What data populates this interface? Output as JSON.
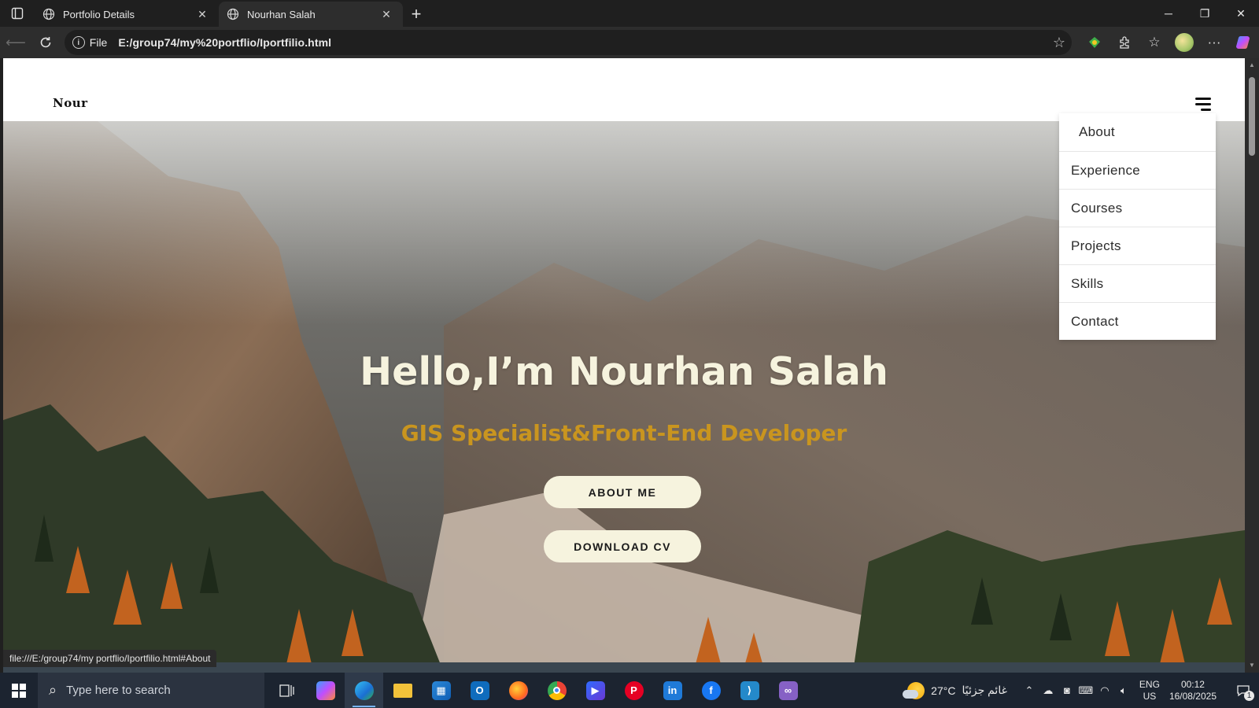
{
  "browser": {
    "tabs": [
      {
        "title": "Portfolio Details",
        "active": false
      },
      {
        "title": "Nourhan Salah",
        "active": true
      }
    ],
    "address": {
      "scheme_label": "File",
      "url": "E:/group74/my%20portflio/Iportfilio.html"
    },
    "status_url": "file:///E:/group74/my portflio/Iportfilio.html#About"
  },
  "site": {
    "logo": "Nour",
    "menu": [
      "About",
      "Experience",
      "Courses",
      "Projects",
      "Skills",
      "Contact"
    ],
    "hero": {
      "title": "Hello,I’m Nourhan Salah",
      "subtitle": "GIS Specialist&Front-End Developer",
      "about_button": "ABOUT ME",
      "cv_button": "DOWNLOAD CV"
    },
    "colors": {
      "hero_text": "#f6f3de",
      "subtitle": "#c9951f",
      "button_bg": "#f6f3de"
    }
  },
  "taskbar": {
    "search_placeholder": "Type here to search",
    "apps": [
      "copilot-icon",
      "edge-icon",
      "file-explorer-icon",
      "store-icon",
      "outlook-icon",
      "firefox-icon",
      "chrome-icon",
      "power-automate-icon",
      "pinterest-icon",
      "linkedin-icon",
      "facebook-icon",
      "vscode-icon",
      "visual-studio-icon"
    ],
    "weather": {
      "temp": "27°C",
      "condition": "غائم جزئيًا"
    },
    "language": {
      "lang": "ENG",
      "region": "US"
    },
    "clock": {
      "time": "00:12",
      "date": "16/08/2025"
    },
    "notifications": "1"
  }
}
